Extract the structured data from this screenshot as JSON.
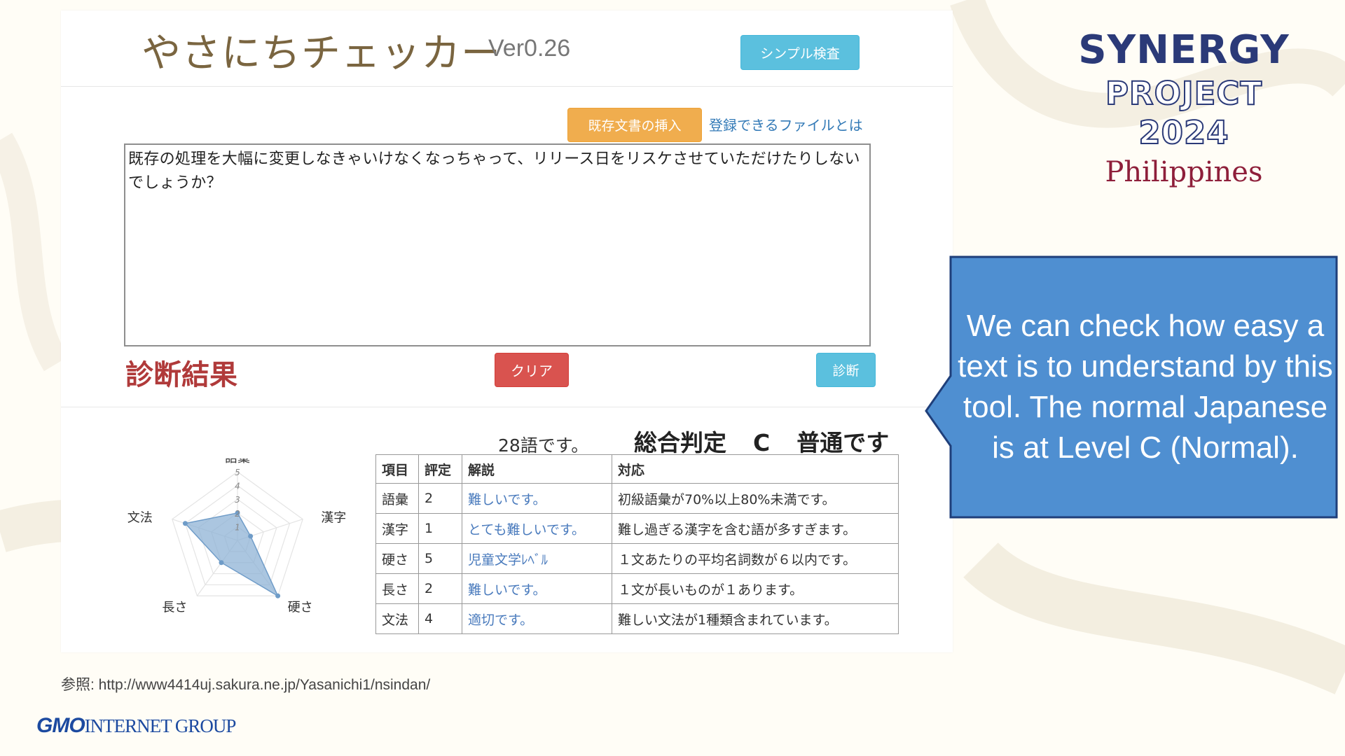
{
  "app": {
    "title": "やさにちチェッカー",
    "version": "Ver0.26",
    "simple_check_button": "シンプル検査",
    "insert_doc_button": "既存文書の挿入",
    "registrable_files_link": "登録できるファイルとは",
    "input_text": "既存の処理を大幅に変更しなきゃいけなくなっちゃって、リリース日をリスケさせていただけたりしないでしょうか？",
    "result_heading": "診断結果",
    "clear_button": "クリア",
    "diagnose_button": "診断",
    "word_count": "28語です。",
    "overall": {
      "label": "総合判定",
      "grade": "C",
      "verdict": "普通です"
    }
  },
  "radar": {
    "axes": [
      "語彙",
      "漢字",
      "硬さ",
      "長さ",
      "文法"
    ],
    "scale_labels": [
      "5",
      "4",
      "3",
      "2",
      "1"
    ],
    "scores": [
      2,
      1,
      5,
      2,
      4
    ],
    "max": 5,
    "fill_color": "#8fb3d6",
    "stroke_color": "#6f9cc8"
  },
  "table": {
    "headers": [
      "項目",
      "評定",
      "解説",
      "対応"
    ],
    "rows": [
      [
        "語彙",
        "2",
        "難しいです。",
        "初級語彙が70%以上80%未満です。"
      ],
      [
        "漢字",
        "1",
        "とても難しいです。",
        "難し過ぎる漢字を含む語が多すぎます。"
      ],
      [
        "硬さ",
        "5",
        "児童文学ﾚﾍﾞﾙ",
        "１文あたりの平均名詞数が６以内です。"
      ],
      [
        "長さ",
        "2",
        "難しいです。",
        "１文が長いものが１あります。"
      ],
      [
        "文法",
        "4",
        "適切です。",
        "難しい文法が1種類含まれています。"
      ]
    ]
  },
  "reference": "参照: http://www4414uj.sakura.ne.jp/Yasanichi1/nsindan/",
  "logos": {
    "synergy_line1": "SYNERGY",
    "synergy_line2": "PROJECT 2024",
    "synergy_line3": "Philippines",
    "gmo_mark": "GMO",
    "gmo_text": "INTERNET GROUP"
  },
  "callout": {
    "text": "We can check how easy a text is to understand by this tool. The normal Japanese is at Level C (Normal).",
    "fill_color": "#4f8fd1",
    "border_color": "#1f3f7a"
  }
}
